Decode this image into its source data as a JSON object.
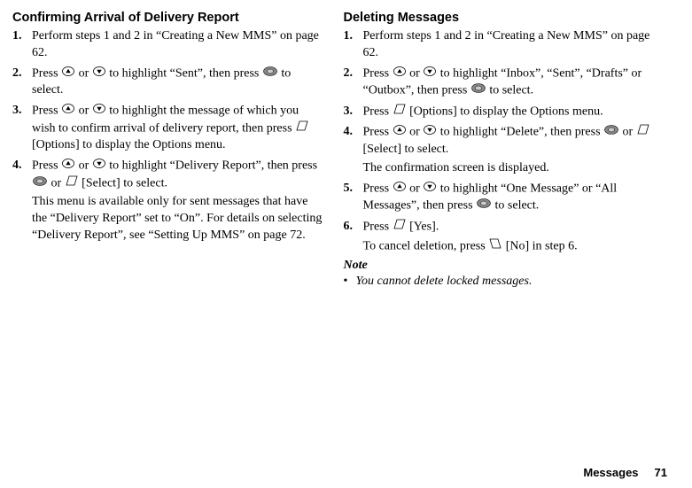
{
  "left": {
    "title": "Confirming Arrival of Delivery Report",
    "steps": [
      {
        "num": "1.",
        "pre": "Perform steps 1 and 2 in “Creating a New MMS” on page 62.",
        "post": ""
      },
      {
        "num": "2.",
        "pre": "Press ",
        "mid1": " or ",
        "mid2": " to highlight “Sent”, then press ",
        "post": " to select."
      },
      {
        "num": "3.",
        "pre": "Press ",
        "mid1": " or ",
        "mid2": " to highlight the message of which you wish to confirm arrival of delivery report, then press ",
        "post": " [Options] to display the Options menu."
      },
      {
        "num": "4.",
        "pre": "Press ",
        "mid1": " or ",
        "mid2": " to highlight “Delivery Report”, then press ",
        "mid3": " or ",
        "post": " [Select] to select.",
        "extra": "This menu is available only for sent messages that have the “Delivery Report” set to “On”. For details on selecting “Delivery Report”, see “Setting Up MMS” on page 72."
      }
    ]
  },
  "right": {
    "title": "Deleting Messages",
    "steps": [
      {
        "num": "1.",
        "pre": "Perform steps 1 and 2 in “Creating a New MMS” on page 62.",
        "post": ""
      },
      {
        "num": "2.",
        "pre": "Press ",
        "mid1": " or ",
        "mid2": " to highlight “Inbox”, “Sent”, “Drafts” or “Outbox”, then press ",
        "post": " to select."
      },
      {
        "num": "3.",
        "pre": "Press ",
        "post": " [Options] to display the Options menu."
      },
      {
        "num": "4.",
        "pre": "Press ",
        "mid1": " or ",
        "mid2": " to highlight “Delete”, then press ",
        "mid3": " or ",
        "post": " [Select] to select.",
        "extra": "The confirmation screen is displayed."
      },
      {
        "num": "5.",
        "pre": "Press ",
        "mid1": " or ",
        "mid2": " to highlight “One Message” or “All Messages”, then press ",
        "post": " to select."
      },
      {
        "num": "6.",
        "pre": "Press ",
        "post": " [Yes].",
        "extra_pre": "To cancel deletion, press ",
        "extra_post": " [No] in step 6."
      }
    ],
    "noteLabel": "Note",
    "noteText": "You cannot delete locked messages."
  },
  "footer": {
    "label": "Messages",
    "page": "71"
  }
}
